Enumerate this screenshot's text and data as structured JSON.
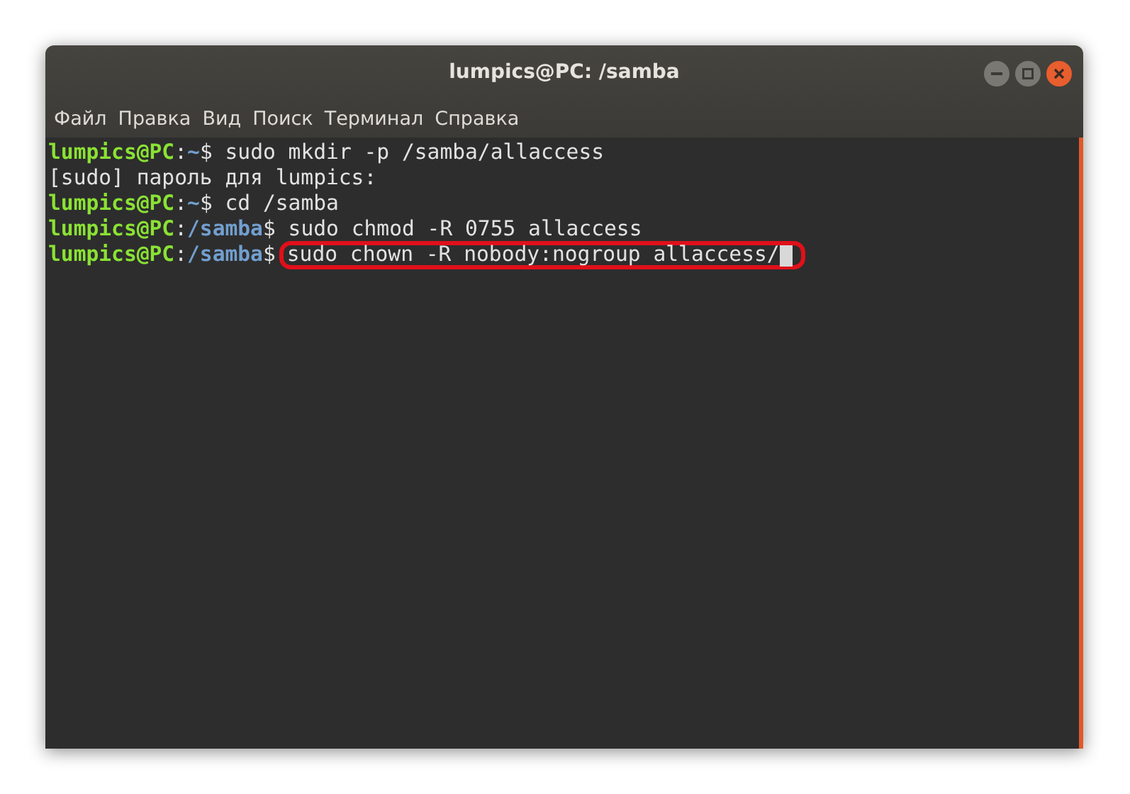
{
  "window": {
    "title": "lumpics@PC: /samba"
  },
  "menu": [
    "Файл",
    "Правка",
    "Вид",
    "Поиск",
    "Терминал",
    "Справка"
  ],
  "lines": [
    {
      "kind": "prompt",
      "user": "lumpics@PC",
      "colon": ":",
      "path": "~",
      "dollar": "$",
      "command": " sudo mkdir -p /samba/allaccess",
      "highlighted": false,
      "cursor": false
    },
    {
      "kind": "output",
      "text": "[sudo] пароль для lumpics:"
    },
    {
      "kind": "prompt",
      "user": "lumpics@PC",
      "colon": ":",
      "path": "~",
      "dollar": "$",
      "command": " cd /samba",
      "highlighted": false,
      "cursor": false
    },
    {
      "kind": "prompt",
      "user": "lumpics@PC",
      "colon": ":",
      "path": "/samba",
      "dollar": "$",
      "command": " sudo chmod -R 0755 allaccess",
      "highlighted": false,
      "cursor": false
    },
    {
      "kind": "prompt",
      "user": "lumpics@PC",
      "colon": ":",
      "path": "/samba",
      "dollar": "$",
      "command": "sudo chown -R nobody:nogroup allaccess/",
      "highlighted": true,
      "cursor": true
    }
  ]
}
